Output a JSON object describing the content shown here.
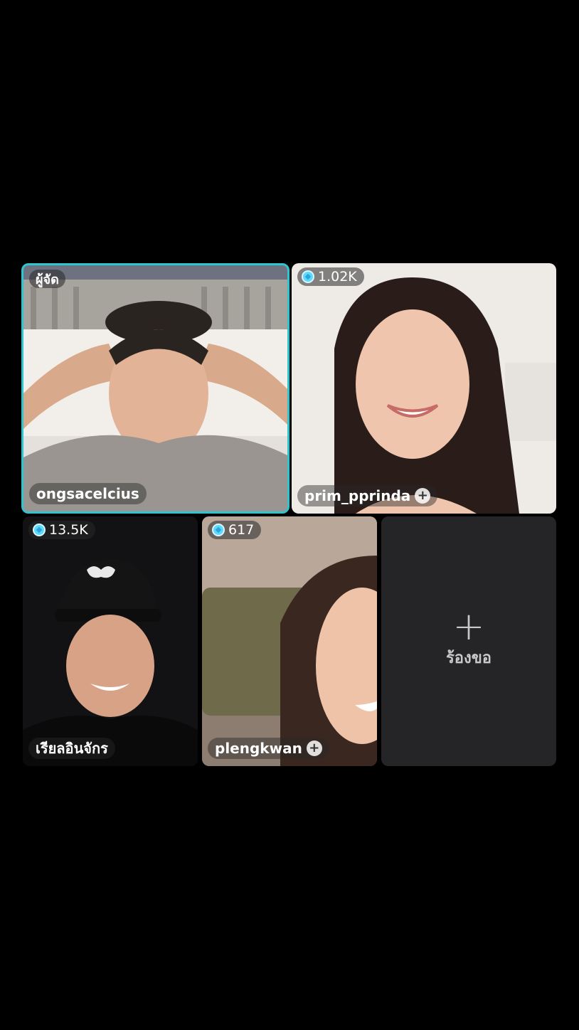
{
  "participants": [
    {
      "username": "ongsacelcius",
      "badge": "ผู้จัด",
      "role": "host"
    },
    {
      "username": "prim_pprinda",
      "viewer_count": "1.02K",
      "follow_icon": "plus-icon"
    },
    {
      "username": "เรียลอินจักร",
      "viewer_count": "13.5K"
    },
    {
      "username": "plengkwan",
      "viewer_count": "617",
      "follow_icon": "plus-icon"
    }
  ],
  "request_slot": {
    "label": "ร้องขอ",
    "icon": "plus-icon"
  },
  "colors": {
    "host_border": "#2ec5cf",
    "gem": "#5fd7ff"
  }
}
